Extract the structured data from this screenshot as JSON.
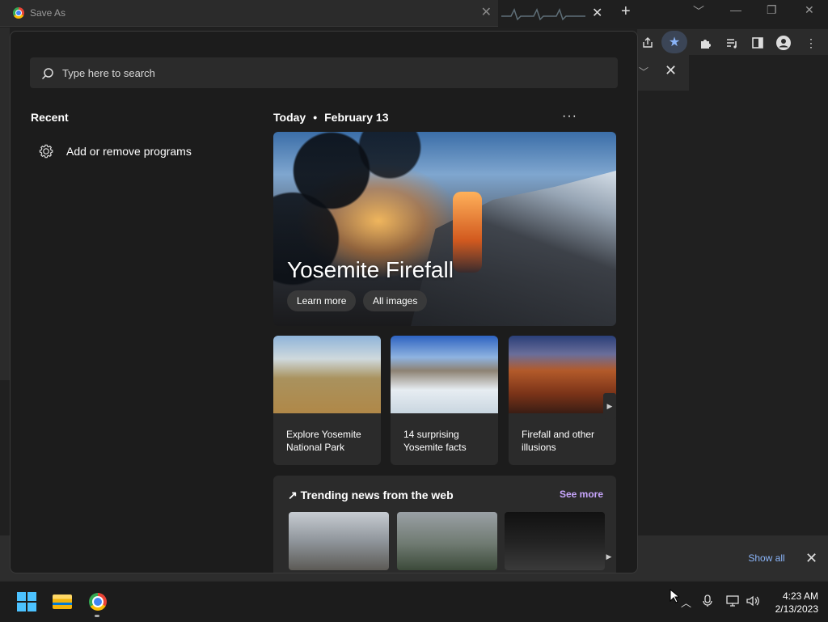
{
  "window": {
    "dialog_title": "Save As",
    "close_glyph": "✕",
    "new_tab_glyph": "+",
    "controls": [
      "﹀",
      "—",
      "❐",
      "✕"
    ]
  },
  "download_bar": {
    "show_all_label": "Show all",
    "close_glyph": "✕"
  },
  "start_panel": {
    "search": {
      "placeholder": "Type here to search",
      "icon": "search-icon"
    },
    "recent": {
      "heading": "Recent",
      "items": [
        {
          "label": "Add or remove programs",
          "icon": "gear-icon"
        }
      ]
    },
    "today": {
      "label": "Today",
      "separator": "•",
      "date": "February 13",
      "more_glyph": "···"
    },
    "hero": {
      "title": "Yosemite Firefall",
      "buttons": [
        "Learn more",
        "All images"
      ]
    },
    "tiles": [
      {
        "caption": "Explore Yosemite National Park"
      },
      {
        "caption": "14 surprising Yosemite facts"
      },
      {
        "caption": "Firefall and other illusions"
      }
    ],
    "tiles_next_glyph": "▶",
    "trending": {
      "heading": "Trending news from the web",
      "see_more": "See more",
      "next_glyph": "▶"
    }
  },
  "taskbar": {
    "apps": [
      "start-icon",
      "file-explorer-icon",
      "chrome-icon"
    ],
    "tray": {
      "chevron": "︿",
      "mic": "🎙",
      "network": "🖧",
      "volume": "🔊"
    },
    "clock": {
      "time": "4:23 AM",
      "date": "2/13/2023"
    }
  },
  "colors": {
    "accent_link": "#8ab4f8",
    "see_more": "#c9a7ff",
    "windows_blue": "#4cc2ff"
  }
}
